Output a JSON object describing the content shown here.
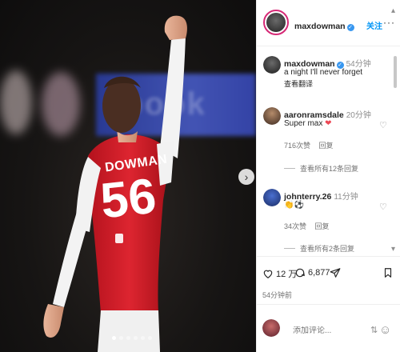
{
  "post": {
    "jersey_name": "DOWMAN",
    "jersey_number": "56",
    "carousel_dots": 6,
    "active_dot": 0
  },
  "header": {
    "username": "maxdowman",
    "verified": true,
    "follow_label": "关注",
    "more_label": "···"
  },
  "caption": {
    "username": "maxdowman",
    "time": "54分钟",
    "text": "a night I'll never forget",
    "translate_label": "查看翻译"
  },
  "comments": [
    {
      "username": "aaronramsdale",
      "time": "20分钟",
      "text": "Super max",
      "emoji": "❤",
      "likes": "716次赞",
      "reply_label": "回复",
      "view_replies": "查看所有12条回复"
    },
    {
      "username": "johnterry.26",
      "time": "11分钟",
      "text": "👏⚽",
      "likes": "34次赞",
      "reply_label": "回复",
      "view_replies": "查看所有2条回复"
    }
  ],
  "actions": {
    "like_count": "12 万",
    "comment_count": "6,877",
    "posted": "54分钟前"
  },
  "compose": {
    "placeholder": "添加评论..."
  },
  "colors": {
    "accent": "#0095f6",
    "verified": "#3897f0",
    "heart_red": "#ed4956",
    "jersey_red": "#d21f2b"
  }
}
